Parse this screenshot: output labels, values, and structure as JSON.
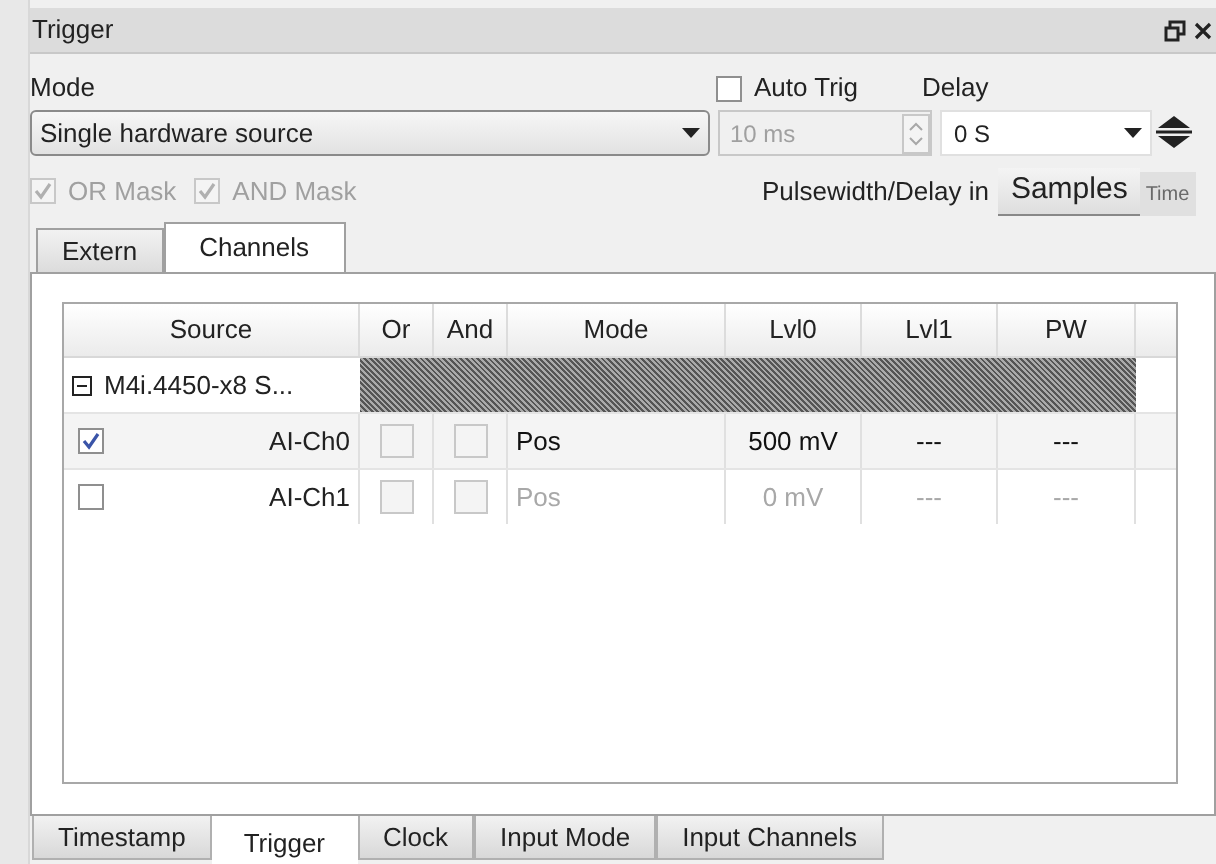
{
  "window": {
    "title": "Trigger"
  },
  "mode": {
    "label": "Mode",
    "value": "Single hardware source"
  },
  "auto_trig": {
    "label": "Auto Trig",
    "checked": false
  },
  "auto_interval": {
    "value": "10 ms",
    "disabled": true
  },
  "delay": {
    "label": "Delay",
    "value": "0 S"
  },
  "masks": [
    {
      "label": "OR Mask",
      "checked": true,
      "disabled": true
    },
    {
      "label": "AND Mask",
      "checked": true,
      "disabled": true
    }
  ],
  "pulsewidth": {
    "label": "Pulsewidth/Delay in",
    "units": [
      {
        "label": "Samples",
        "selected": true
      },
      {
        "label": "Time",
        "selected": false
      }
    ]
  },
  "tabs": [
    {
      "label": "Extern",
      "selected": false
    },
    {
      "label": "Channels",
      "selected": true
    }
  ],
  "table": {
    "columns": [
      "Source",
      "Or",
      "And",
      "Mode",
      "Lvl0",
      "Lvl1",
      "PW"
    ],
    "groups": [
      {
        "label": "M4i.4450-x8 S...",
        "expanded": true,
        "rows": [
          {
            "enabled": true,
            "source": "AI-Ch0",
            "or": false,
            "and": false,
            "mode": "Pos",
            "lvl0": "500 mV",
            "lvl1": "---",
            "pw": "---"
          },
          {
            "enabled": false,
            "source": "AI-Ch1",
            "or": false,
            "and": false,
            "mode": "Pos",
            "lvl0": "0 mV",
            "lvl1": "---",
            "pw": "---"
          }
        ]
      }
    ]
  },
  "bottom_tabs": [
    {
      "label": "Timestamp",
      "selected": false
    },
    {
      "label": "Trigger",
      "selected": true
    },
    {
      "label": "Clock",
      "selected": false
    },
    {
      "label": "Input Mode",
      "selected": false
    },
    {
      "label": "Input Channels",
      "selected": false
    }
  ]
}
